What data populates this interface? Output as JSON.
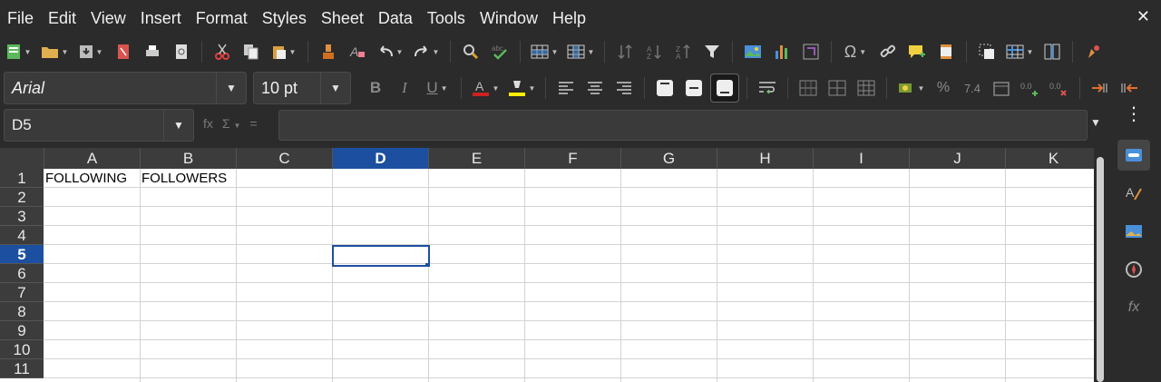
{
  "menubar": {
    "items": [
      "File",
      "Edit",
      "View",
      "Insert",
      "Format",
      "Styles",
      "Sheet",
      "Data",
      "Tools",
      "Window",
      "Help"
    ],
    "close_glyph": "✕"
  },
  "toolbar1": {
    "icons": [
      "new-spreadsheet-icon",
      "open-icon",
      "save-icon",
      "export-pdf-icon",
      "print-icon",
      "print-preview-icon",
      "cut-icon",
      "copy-icon",
      "paste-icon",
      "clone-formatting-icon",
      "clear-formatting-icon",
      "undo-icon",
      "redo-icon",
      "find-replace-icon",
      "spellcheck-icon",
      "row-icon",
      "column-icon",
      "sort-icon",
      "sort-ascending-icon",
      "sort-descending-icon",
      "autofilter-icon",
      "insert-image-icon",
      "insert-chart-icon",
      "pivot-table-icon",
      "special-character-icon",
      "hyperlink-icon",
      "comment-icon",
      "headers-footers-icon",
      "define-print-area-icon",
      "freeze-rows-columns-icon",
      "split-window-icon",
      "show-draw-functions-icon"
    ]
  },
  "font": {
    "name": "Arial",
    "size": "10 pt"
  },
  "toolbar2": {
    "accent_font_color": "#cc2222",
    "highlight_color": "#ffee00"
  },
  "formula_bar": {
    "name_box": "D5",
    "fx": "fx",
    "sigma": "Σ",
    "equals": "=",
    "value": ""
  },
  "sheet": {
    "columns": [
      "A",
      "B",
      "C",
      "D",
      "E",
      "F",
      "G",
      "H",
      "I",
      "J",
      "K"
    ],
    "rows": [
      "1",
      "2",
      "3",
      "4",
      "5",
      "6",
      "7",
      "8",
      "9",
      "10",
      "11"
    ],
    "active_column": "D",
    "active_row": "5",
    "cells": {
      "A1": "FOLLOWING",
      "B1": "FOLLOWERS"
    }
  },
  "sidebar": {
    "icons": [
      "properties-icon",
      "styles-icon",
      "gallery-icon",
      "navigator-icon",
      "functions-icon"
    ]
  },
  "colors": {
    "selection": "#1c4fa0",
    "background": "#2b2b2b"
  }
}
